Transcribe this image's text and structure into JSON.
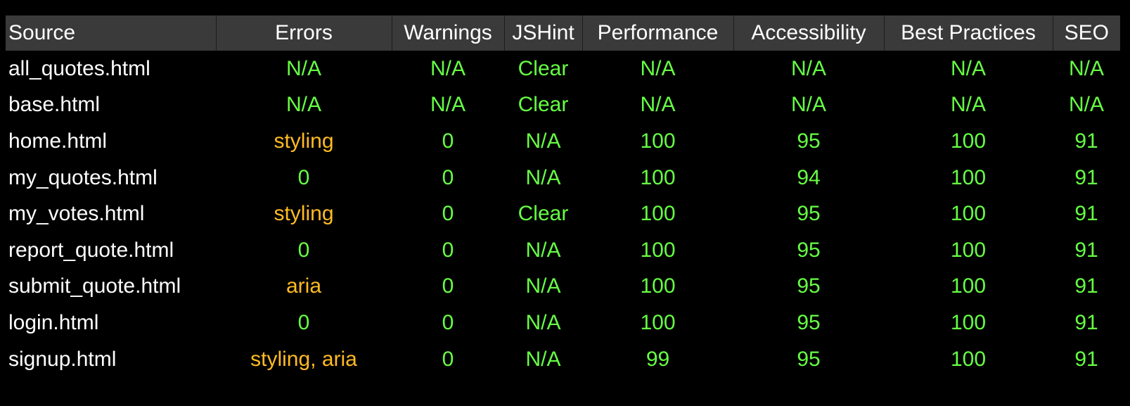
{
  "colors": {
    "background": "#000000",
    "header_bg": "#3a3a3a",
    "header_text": "#ffffff",
    "source_text": "#ffffff",
    "ok_text": "#66ff44",
    "issue_text": "#ffbb22"
  },
  "table": {
    "headers": [
      "Source",
      "Errors",
      "Warnings",
      "JSHint",
      "Performance",
      "Accessibility",
      "Best Practices",
      "SEO"
    ],
    "rows": [
      [
        "all_quotes.html",
        "N/A",
        "N/A",
        "Clear",
        "N/A",
        "N/A",
        "N/A",
        "N/A"
      ],
      [
        "base.html",
        "N/A",
        "N/A",
        "Clear",
        "N/A",
        "N/A",
        "N/A",
        "N/A"
      ],
      [
        "home.html",
        "styling",
        "0",
        "N/A",
        "100",
        "95",
        "100",
        "91"
      ],
      [
        "my_quotes.html",
        "0",
        "0",
        "N/A",
        "100",
        "94",
        "100",
        "91"
      ],
      [
        "my_votes.html",
        "styling",
        "0",
        "Clear",
        "100",
        "95",
        "100",
        "91"
      ],
      [
        "report_quote.html",
        "0",
        "0",
        "N/A",
        "100",
        "95",
        "100",
        "91"
      ],
      [
        "submit_quote.html",
        "aria",
        "0",
        "N/A",
        "100",
        "95",
        "100",
        "91"
      ],
      [
        "login.html",
        "0",
        "0",
        "N/A",
        "100",
        "95",
        "100",
        "91"
      ],
      [
        "signup.html",
        "styling, aria",
        "0",
        "N/A",
        "99",
        "95",
        "100",
        "91"
      ]
    ]
  }
}
